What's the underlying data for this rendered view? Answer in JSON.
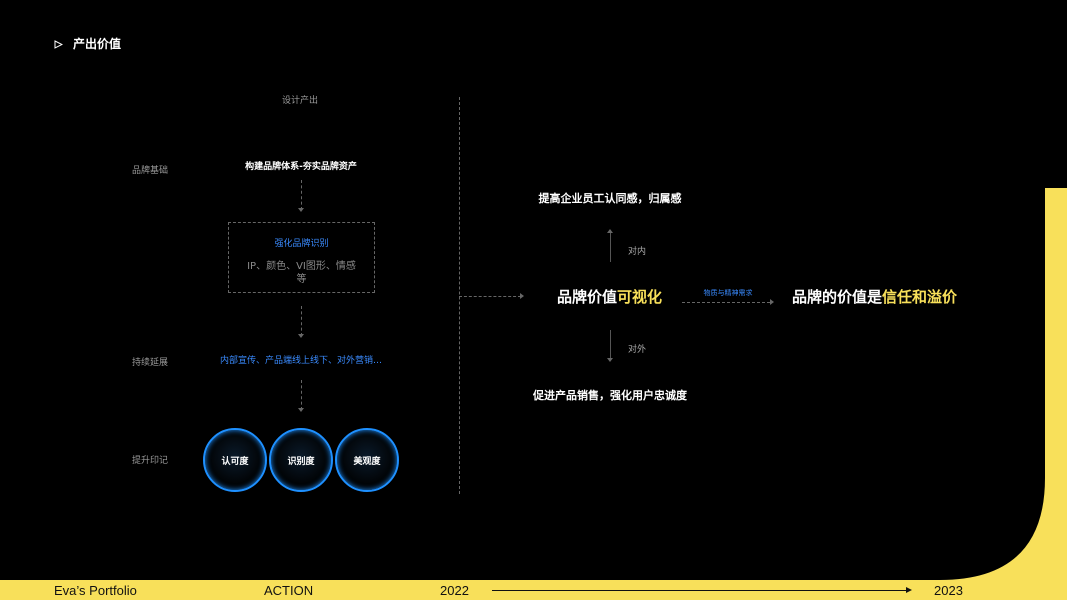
{
  "header": {
    "title": "产出价值"
  },
  "left": {
    "design_output": "设计产出",
    "brand_base_label": "品牌基础",
    "brand_base_text": "构建品牌体系-夯实品牌资产",
    "box_title": "强化品牌识别",
    "box_line1": "IP、颜色、VI图形、情感",
    "box_line2": "等",
    "extend_label": "持续延展",
    "extend_text": "内部宣传、产品端线上线下、对外营销…",
    "impression_label": "提升印记",
    "circles": [
      "认可度",
      "识别度",
      "美观度"
    ]
  },
  "right": {
    "top_text": "提高企业员工认同感，归属感",
    "inner_label": "对内",
    "main_left_1": "品牌价值",
    "main_left_2": "可视化",
    "arrow_label": "物质与精神需求",
    "main_right_1": "品牌的价值是",
    "main_right_2": "信任和溢价",
    "outer_label": "对外",
    "bottom_text": "促进产品销售，强化用户忠诚度"
  },
  "footer": {
    "portfolio": "Eva’s Portfolio",
    "section": "ACTION",
    "year_start": "2022",
    "year_end": "2023"
  },
  "colors": {
    "accent_yellow": "#f8e05a",
    "accent_blue": "#3a8bff",
    "circle_ring": "#1e90ff"
  }
}
